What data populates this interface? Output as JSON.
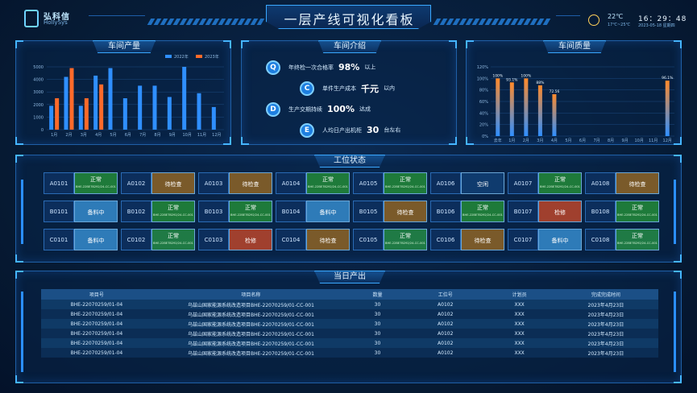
{
  "header": {
    "logo_name": "弘科信",
    "logo_sub": "HollySys",
    "title": "一层产线可视化看板",
    "temperature": "22℃",
    "temp_range": "17℃~25℃",
    "time": "16：29：48",
    "date": "2023-05-18 星期四",
    "weather_icon": "sun-icon"
  },
  "panels": {
    "output": "车间产量",
    "intro": "车间介绍",
    "quality": "车间质量",
    "station": "工位状态",
    "today": "当日产出"
  },
  "output_chart": {
    "legend": [
      "2022年",
      "2023年"
    ],
    "colors": [
      "#2f8fff",
      "#ff6a2a"
    ],
    "yticks": [
      "5000",
      "4000",
      "3000",
      "2000",
      "1000",
      "0"
    ],
    "categories": [
      "1月",
      "2月",
      "3月",
      "4月",
      "5月",
      "6月",
      "7月",
      "8月",
      "9月",
      "10月",
      "11月",
      "12月"
    ],
    "series_2022": [
      1900,
      4200,
      1900,
      4300,
      4900,
      2500,
      3500,
      3500,
      2600,
      5000,
      2900,
      1800
    ],
    "series_2023": [
      2500,
      4900,
      2500,
      3600,
      null,
      null,
      null,
      null,
      null,
      null,
      null,
      null
    ]
  },
  "intro": [
    {
      "badge": "Q",
      "prefix": "年终检一次合格率",
      "value": "98%",
      "suffix": "以上"
    },
    {
      "badge": "C",
      "prefix": "单件生产成本",
      "value": "千元",
      "suffix": "以内"
    },
    {
      "badge": "D",
      "prefix": "生产交期持续",
      "value": "100%",
      "suffix": "达成"
    },
    {
      "badge": "E",
      "prefix": "人均日产出机柜",
      "value": "30",
      "suffix": "台左右"
    }
  ],
  "quality_chart": {
    "yticks": [
      "120%",
      "100%",
      "80%",
      "60%",
      "40%",
      "20%",
      "0%"
    ],
    "categories": [
      "去年",
      "1月",
      "2月",
      "3月",
      "4月",
      "5月",
      "6月",
      "7月",
      "8月",
      "9月",
      "10月",
      "11月",
      "12月"
    ],
    "values": [
      100,
      93.1,
      100,
      88,
      72.56,
      null,
      null,
      null,
      null,
      null,
      null,
      null,
      96.1
    ],
    "labels": [
      "100%",
      "93.1%",
      "100%",
      "88%",
      "72.56",
      "",
      "",
      "",
      "",
      "",
      "",
      "",
      "96.1%"
    ]
  },
  "stations": [
    [
      {
        "code": "A0101",
        "status": "正常",
        "pn": "BHE-22BE7B292/24-CC-001",
        "type": "normal"
      },
      {
        "code": "A0102",
        "status": "待检查",
        "pn": "",
        "type": "wait"
      },
      {
        "code": "A0103",
        "status": "待检查",
        "pn": "",
        "type": "wait"
      },
      {
        "code": "A0104",
        "status": "正常",
        "pn": "BHE-22BE7B292/24-CC-001",
        "type": "normal"
      },
      {
        "code": "A0105",
        "status": "正常",
        "pn": "BHE-22BE7B292/24-CC-001",
        "type": "normal"
      },
      {
        "code": "A0106",
        "status": "空闲",
        "pn": "",
        "type": "idle"
      },
      {
        "code": "A0107",
        "status": "正常",
        "pn": "BHE-22BE7B292/24-CC-001",
        "type": "normal"
      },
      {
        "code": "A0108",
        "status": "待检查",
        "pn": "",
        "type": "wait"
      }
    ],
    [
      {
        "code": "B0101",
        "status": "备料中",
        "pn": "",
        "type": "prep"
      },
      {
        "code": "B0102",
        "status": "正常",
        "pn": "BHE-22BE7B292/24-CC-001",
        "type": "normal"
      },
      {
        "code": "B0103",
        "status": "正常",
        "pn": "BHE-22BE7B292/24-CC-001",
        "type": "normal"
      },
      {
        "code": "B0104",
        "status": "备料中",
        "pn": "",
        "type": "prep"
      },
      {
        "code": "B0105",
        "status": "待检查",
        "pn": "",
        "type": "wait"
      },
      {
        "code": "B0106",
        "status": "正常",
        "pn": "BHE-22BE7B292/24-CC-001",
        "type": "normal"
      },
      {
        "code": "B0107",
        "status": "检修",
        "pn": "",
        "type": "repair"
      },
      {
        "code": "B0108",
        "status": "正常",
        "pn": "BHE-22BE7B292/24-CC-001",
        "type": "normal"
      }
    ],
    [
      {
        "code": "C0101",
        "status": "备料中",
        "pn": "",
        "type": "prep"
      },
      {
        "code": "C0102",
        "status": "正常",
        "pn": "BHE-22BE7B292/24-CC-001",
        "type": "stop"
      },
      {
        "code": "C0103",
        "status": "检修",
        "pn": "",
        "type": "repair"
      },
      {
        "code": "C0104",
        "status": "待检查",
        "pn": "",
        "type": "wait"
      },
      {
        "code": "C0105",
        "status": "正常",
        "pn": "BHE-22BE7B292/24-CC-001",
        "type": "stop"
      },
      {
        "code": "C0106",
        "status": "待检查",
        "pn": "",
        "type": "wait"
      },
      {
        "code": "C0107",
        "status": "备料中",
        "pn": "",
        "type": "prep"
      },
      {
        "code": "C0108",
        "status": "正常",
        "pn": "BHE-22BE7B292/24-CC-001",
        "type": "stop"
      }
    ]
  ],
  "table": {
    "headers": [
      "项目号",
      "项目名称",
      "数量",
      "工位号",
      "计划员",
      "完成完成时间"
    ],
    "rows": [
      [
        "BHE-22070259/01-04",
        "乌兹山国家能源系统改造项目BHE-22070259/01-CC-001",
        "30",
        "A0102",
        "XXX",
        "2023年4月23日"
      ],
      [
        "BHE-22070259/01-04",
        "乌兹山国家能源系统改造项目BHE-22070259/01-CC-001",
        "30",
        "A0102",
        "XXX",
        "2023年4月23日"
      ],
      [
        "BHE-22070259/01-04",
        "乌兹山国家能源系统改造项目BHE-22070259/01-CC-001",
        "30",
        "A0102",
        "XXX",
        "2023年4月23日"
      ],
      [
        "BHE-22070259/01-04",
        "乌兹山国家能源系统改造项目BHE-22070259/01-CC-001",
        "30",
        "A0102",
        "XXX",
        "2023年4月23日"
      ],
      [
        "BHE-22070259/01-04",
        "乌兹山国家能源系统改造项目BHE-22070259/01-CC-001",
        "30",
        "A0102",
        "XXX",
        "2023年4月23日"
      ],
      [
        "BHE-22070259/01-04",
        "乌兹山国家能源系统改造项目BHE-22070259/01-CC-001",
        "30",
        "A0102",
        "XXX",
        "2023年4月23日"
      ]
    ]
  }
}
